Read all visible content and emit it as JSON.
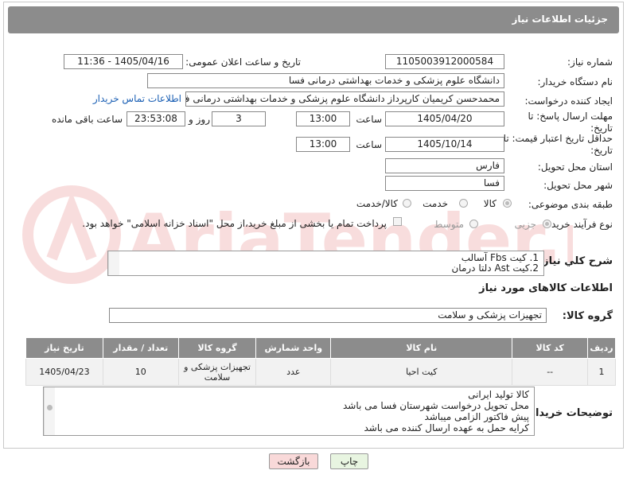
{
  "header": {
    "title": "جزئیات اطلاعات نیاز"
  },
  "labels": {
    "need_number": "شماره نیاز:",
    "announce_datetime": "تاریخ و ساعت اعلان عمومی:",
    "buyer_org": "نام دستگاه خریدار:",
    "requester": "ایجاد کننده درخواست:",
    "deadline": "مهلت ارسال پاسخ: تا تاریخ:",
    "time": "ساعت",
    "day_and": "روز و",
    "time_remaining": "ساعت باقی مانده",
    "min_price_validity": "حداقل تاریخ اعتبار قیمت: تا تاریخ:",
    "time2": "ساعت",
    "province": "استان محل تحویل:",
    "city": "شهر محل تحویل:",
    "category": "طبقه بندی موضوعی:",
    "process": "نوع فرآیند خرید :",
    "need_desc": "شرح کلي نياز:",
    "goods_info": "اطلاعات کالاهای مورد نیاز",
    "goods_group": "گروه کالا:",
    "buyer_notes": "توضیحات خریدار:"
  },
  "values": {
    "need_number": "1105003912000584",
    "announce_datetime": "1405/04/16 - 11:36",
    "buyer_org": "دانشگاه علوم پزشکی و خدمات بهداشتی درمانی فسا",
    "requester": "محمدحسن کریمیان کارپرداز دانشگاه علوم پزشکی و خدمات بهداشتی درمانی ف",
    "contact_link": "اطلاعات تماس خریدار",
    "deadline_date": "1405/04/20",
    "deadline_time": "13:00",
    "days": "3",
    "remaining": "23:53:08",
    "validity_date": "1405/10/14",
    "validity_time": "13:00",
    "province": "فارس",
    "city": "فسا",
    "goods_group": "تجهیزات پزشکی و سلامت"
  },
  "category_options": [
    "کالا",
    "خدمت",
    "کالا/خدمت"
  ],
  "process_options": [
    "جزیی",
    "متوسط"
  ],
  "payment_note": "پرداخت تمام یا بخشی از مبلغ خرید،از محل \"اسناد خزانه اسلامی\" خواهد بود.",
  "need_desc_lines": [
    "1. کیت Fbs آسالب",
    "2.کیت Ast دلتا درمان"
  ],
  "table": {
    "headers": [
      "ردیف",
      "کد کالا",
      "نام کالا",
      "واحد شمارش",
      "گروه کالا",
      "تعداد / مقدار",
      "تاریخ نیاز"
    ],
    "rows": [
      {
        "row": "1",
        "code": "--",
        "name": "کیت احیا",
        "unit": "عدد",
        "group": "تجهیزات پزشکی و سلامت",
        "qty": "10",
        "date": "1405/04/23"
      }
    ]
  },
  "notes_lines": [
    "کالا تولید ایرانی",
    "محل تحویل درخواست شهرستان فسا می باشد",
    "پیش فاکتور الزامی میباشد",
    "کرایه حمل به عهده ارسال کننده می باشد"
  ],
  "buttons": {
    "print": "چاپ",
    "back": "بازگشت"
  },
  "colors": {
    "header_bg": "#8c8c8c",
    "link": "#1a5fb4",
    "back_button_bg": "#f9d9d9",
    "print_button_bg": "#e8f5e1"
  }
}
